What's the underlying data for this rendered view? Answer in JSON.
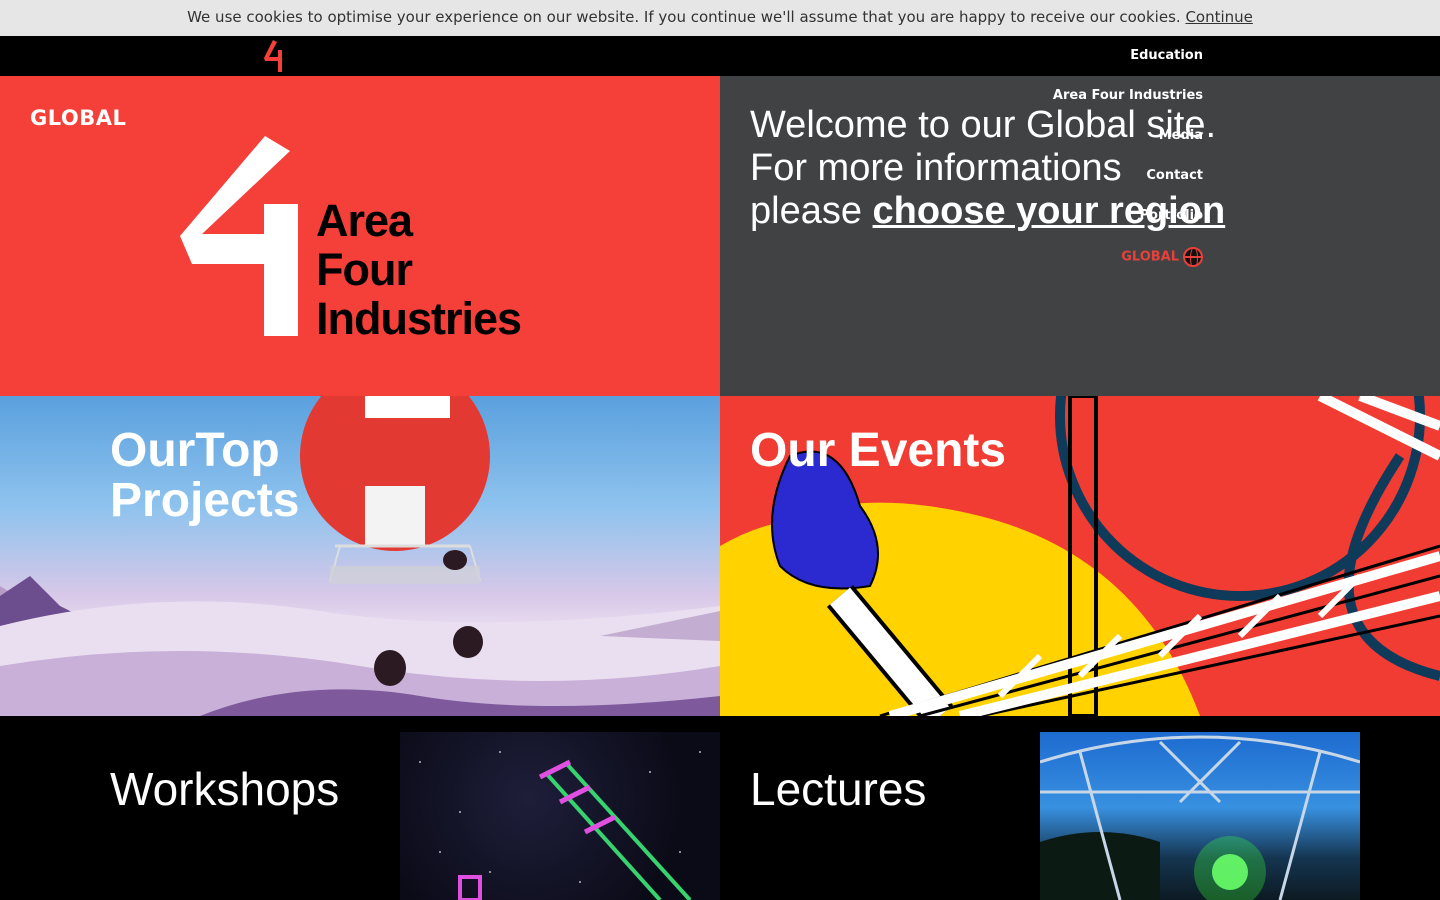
{
  "cookie": {
    "message": "We use cookies to optimise your experience on our website. If you continue we'll assume that you are happy to receive our cookies.",
    "continue_label": "Continue"
  },
  "nav": {
    "items": [
      {
        "label": "Education"
      },
      {
        "label": "Area Four Industries"
      },
      {
        "label": "Media"
      },
      {
        "label": "Contact"
      },
      {
        "label": "Portfolio"
      },
      {
        "label": "GLOBAL"
      }
    ]
  },
  "hero": {
    "region_label": "GLOBAL",
    "brand_line1": "Area",
    "brand_line2": "Four",
    "brand_line3": "Industries",
    "welcome_line1": "Welcome to our Global site.",
    "welcome_line2": "For more informations",
    "welcome_line3_prefix": "please",
    "welcome_link": "choose your region"
  },
  "tiles": {
    "projects_line1": "OurTop",
    "projects_line2": "Projects",
    "events_title": "Our Events",
    "workshops_title": "Workshops",
    "lectures_title": "Lectures"
  },
  "colors": {
    "brand_red": "#f5403a",
    "hero_grey": "#414244",
    "cookie_bg": "#e6e6e6"
  },
  "icons": {
    "logo": "area-four-logo",
    "globe": "globe-icon"
  }
}
